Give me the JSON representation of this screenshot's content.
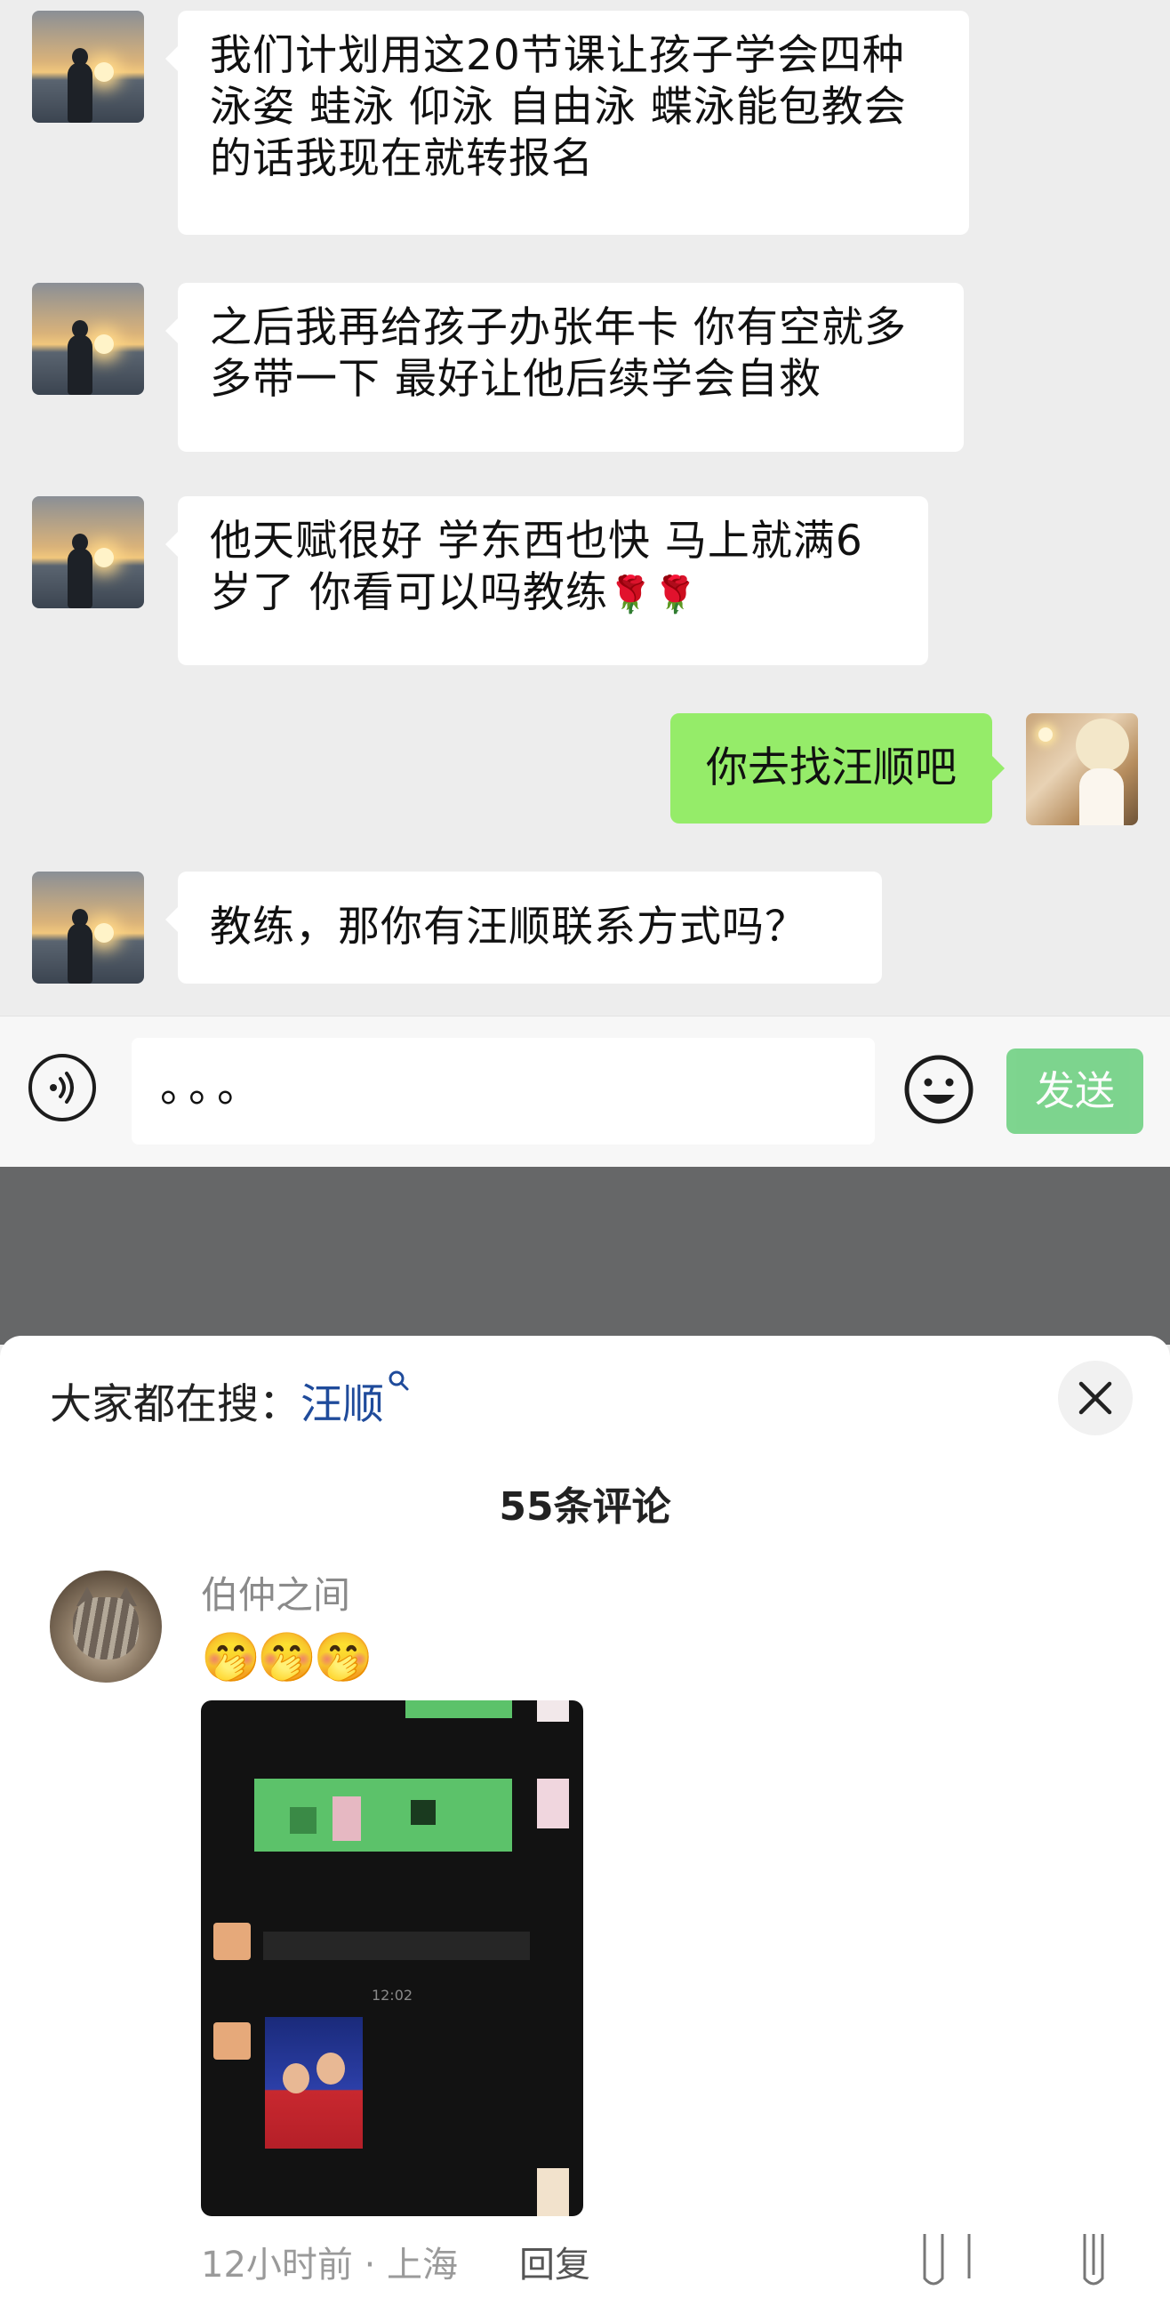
{
  "chat": {
    "messages": [
      {
        "side": "left",
        "text": "我们计划用这20节课让孩子学会四种泳姿 蛙泳 仰泳 自由泳 蝶泳能包教会的话我现在就转报名"
      },
      {
        "side": "left",
        "text": "之后我再给孩子办张年卡 你有空就多多带一下 最好让他后续学会自救"
      },
      {
        "side": "left",
        "text": "他天赋很好 学东西也快 马上就满6岁了 你看可以吗教练",
        "emoji": "🌹🌹"
      },
      {
        "side": "right",
        "text": "你去找汪顺吧"
      },
      {
        "side": "left",
        "text": "教练，那你有汪顺联系方式吗？"
      }
    ]
  },
  "input_bar": {
    "value": "。。。",
    "send_label": "发送"
  },
  "comments": {
    "search_prefix": "大家都在搜：",
    "search_term": "汪顺",
    "count_label": "55条评论",
    "items": [
      {
        "author": "伯仲之间",
        "emoji": "🤭🤭🤭",
        "image_time": "12:02",
        "meta": "12小时前 · 上海",
        "reply_label": "回复"
      }
    ]
  },
  "colors": {
    "my_bubble": "#95ec69",
    "send_button": "#4fc766",
    "search_term": "#1f4b9b"
  }
}
